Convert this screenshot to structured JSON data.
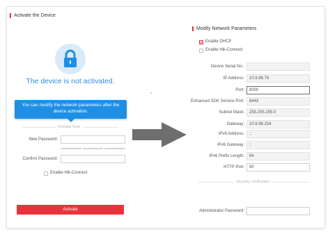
{
  "left_panel": {
    "title": "Activate the Device",
    "status": "The device is not activated.",
    "tooltip": "You can modify the network parameters after the device activation.",
    "section": "Activate Now",
    "new_password_label": "New Password:",
    "confirm_password_label": "Confirm Password:",
    "hik_connect_label": "Enable Hik-Connect",
    "activate_button": "Activate"
  },
  "right_panel": {
    "title": "Modify Network Parameters",
    "enable_dhcp": "Enable DHCP",
    "enable_hik_connect": "Enable Hik-Connect",
    "fields": [
      {
        "label": "Device Serial No.:",
        "value": ""
      },
      {
        "label": "IP Address:",
        "value": "10.9.96.79"
      },
      {
        "label": "Port:",
        "value": "8000"
      },
      {
        "label": "Enhanced SDK Service Port:",
        "value": "8443"
      },
      {
        "label": "Subnet Mask:",
        "value": "255.255.255.0"
      },
      {
        "label": "Gateway:",
        "value": "10.9.96.254"
      },
      {
        "label": "IPv6 Address:",
        "value": "::"
      },
      {
        "label": "IPv6 Gateway:",
        "value": "::"
      },
      {
        "label": "IPv6 Prefix Length:",
        "value": "64"
      },
      {
        "label": "HTTP Port:",
        "value": "80"
      }
    ],
    "section": "Security Verification",
    "admin_password_label": "Administrator Password:"
  },
  "colors": {
    "accent_red": "#e8333c",
    "info_blue": "#1f8fe6",
    "status_blue": "#2c8de0"
  }
}
